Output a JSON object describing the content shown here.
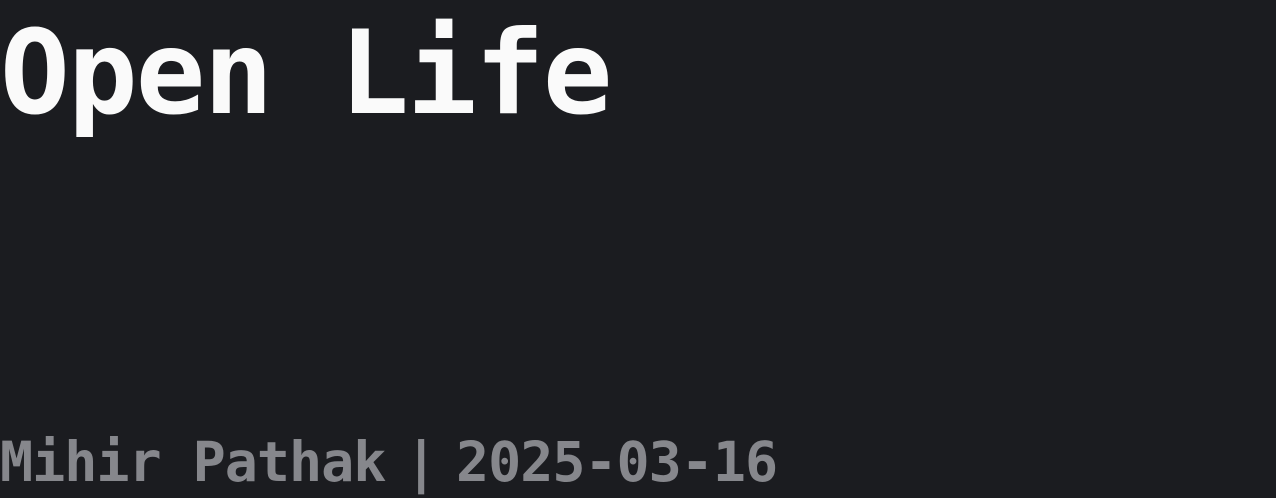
{
  "post": {
    "title": "Open Life",
    "author": "Mihir Pathak",
    "separator": "|",
    "date": "2025-03-16"
  },
  "colors": {
    "background": "#1b1c20",
    "title": "#fafafa",
    "meta": "#86878c"
  }
}
